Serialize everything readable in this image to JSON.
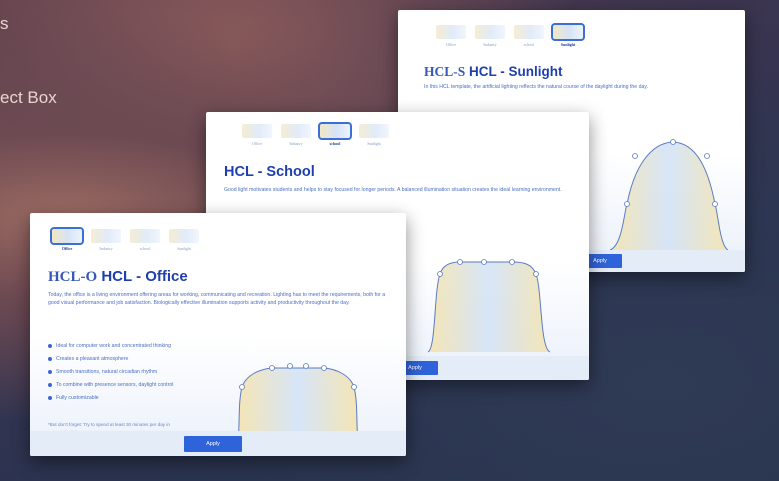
{
  "background": {
    "text_line1": "s",
    "text_line2": "ect Box"
  },
  "colors": {
    "accent": "#2f63d9",
    "title": "#1f3fae",
    "text": "#4a6fc7",
    "warm": "#f4e3ad",
    "cool": "#cfe0f7"
  },
  "cards": {
    "sunlight": {
      "tabs": [
        "Office",
        "Industry",
        "school",
        "Sunlight"
      ],
      "active_tab": "Sunlight",
      "title_ghost": "HCL-S",
      "title": "HCL  -  Sunlight",
      "description": "In this HCL template, the artificial lighting reflects the natural course of the daylight during the day.",
      "apply_label": "Apply"
    },
    "school": {
      "tabs": [
        "Office",
        "Industry",
        "school",
        "Sunlight"
      ],
      "active_tab": "school",
      "title": "HCL  -  School",
      "description": "Good light motivates students and helps to stay focused for longer periods. A balanced illumination situation creates the ideal learning environment.",
      "apply_label": "Apply"
    },
    "office": {
      "tabs": [
        "Office",
        "Industry",
        "school",
        "Sunlight"
      ],
      "active_tab": "Office",
      "title_ghost": "HCL-O",
      "title": "HCL  -  Office",
      "description": "Today, the office is a living environment offering areas for working, communicating and recreation. Lighting has to meet the requirements, both for a good visual performance and job satisfaction. Biologically effective illumination supports activity and productivity throughout the day.",
      "features": [
        "Ideal for computer work and concentrated thinking",
        "Creates a pleasant atmosphere",
        "Smooth transitions, natural circadian rhythm",
        "To combine with presence sensors, daylight control",
        "Fully customizable"
      ],
      "note": "*But don't forget: Try to spend at least 30 minutes per day in natural daylight!",
      "apply_label": "Apply"
    }
  }
}
